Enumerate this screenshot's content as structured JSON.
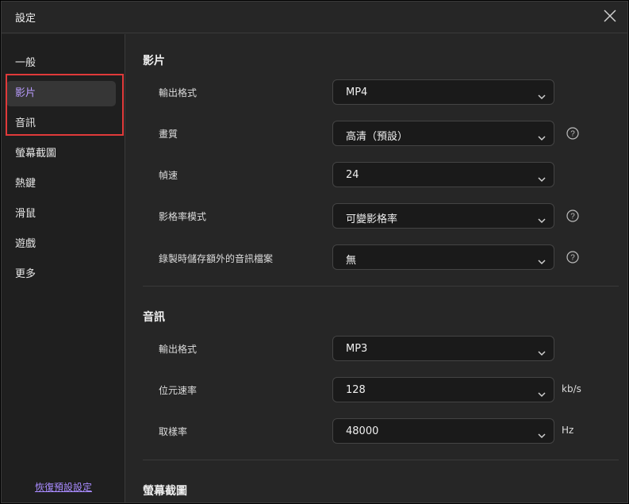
{
  "window": {
    "title": "設定"
  },
  "sidebar": {
    "items": [
      {
        "label": "一般"
      },
      {
        "label": "影片",
        "active": true
      },
      {
        "label": "音訊"
      },
      {
        "label": "螢幕截圖"
      },
      {
        "label": "熱鍵"
      },
      {
        "label": "滑鼠"
      },
      {
        "label": "遊戲"
      },
      {
        "label": "更多"
      }
    ],
    "restore_label": "恢復預設設定"
  },
  "video": {
    "title": "影片",
    "rows": [
      {
        "label": "輸出格式",
        "value": "MP4",
        "help": false
      },
      {
        "label": "畫質",
        "value": "高清（預設）",
        "help": true
      },
      {
        "label": "幀速",
        "value": "24",
        "help": false
      },
      {
        "label": "影格率模式",
        "value": "可變影格率",
        "help": true
      },
      {
        "label": "錄製時儲存額外的音訊檔案",
        "value": "無",
        "help": true
      }
    ]
  },
  "audio": {
    "title": "音訊",
    "rows": [
      {
        "label": "輸出格式",
        "value": "MP3",
        "unit": ""
      },
      {
        "label": "位元速率",
        "value": "128",
        "unit": "kb/s"
      },
      {
        "label": "取樣率",
        "value": "48000",
        "unit": "Hz"
      }
    ]
  },
  "screenshot": {
    "title": "螢幕截圖"
  },
  "colors": {
    "accent": "#b99cff",
    "highlight": "#e03a3a",
    "background": "#262626"
  }
}
